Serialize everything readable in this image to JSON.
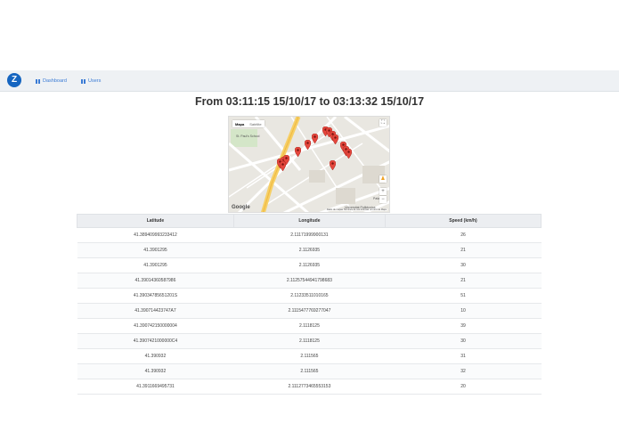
{
  "navbar": {
    "logo_text": "Z",
    "items": [
      {
        "label": "Dashboard",
        "icon": "bar-chart-icon"
      },
      {
        "label": "Users",
        "icon": "bar-chart-icon"
      }
    ]
  },
  "page": {
    "title": "From 03:11:15 15/10/17 to 03:13:32 15/10/17"
  },
  "map": {
    "type_buttons": {
      "map": "Mapa",
      "satellite": "Satélite"
    },
    "google_label": "Google",
    "footer": "Datos de mapas   Términos de uso   Informar un error de Maps",
    "labels": {
      "school": "St. Paul's School",
      "university": "Universitat Politècnica",
      "palau": "Palau Rei"
    },
    "marker_count": 15
  },
  "table": {
    "headers": [
      "Latitude",
      "Longitude",
      "Speed (km/h)"
    ],
    "rows": [
      [
        "41.389409993233412",
        "2.11171999900131",
        "26"
      ],
      [
        "41.3901295",
        "2.1126935",
        "21"
      ],
      [
        "41.3901295",
        "2.1126935",
        "30"
      ],
      [
        "41.39014360587986",
        "2.11257544941798683",
        "21"
      ],
      [
        "41.39034785651201S",
        "2.11233511010165",
        "51"
      ],
      [
        "41.390714423747A7",
        "2.1115477769277047",
        "10"
      ],
      [
        "41.390742150000004",
        "2.1118125",
        "39"
      ],
      [
        "41.3907421000000C4",
        "2.1118125",
        "30"
      ],
      [
        "41.390932",
        "2.111565",
        "31"
      ],
      [
        "41.390932",
        "2.111565",
        "32"
      ],
      [
        "41.3911669495731",
        "2.1112773465553153",
        "20"
      ]
    ]
  }
}
